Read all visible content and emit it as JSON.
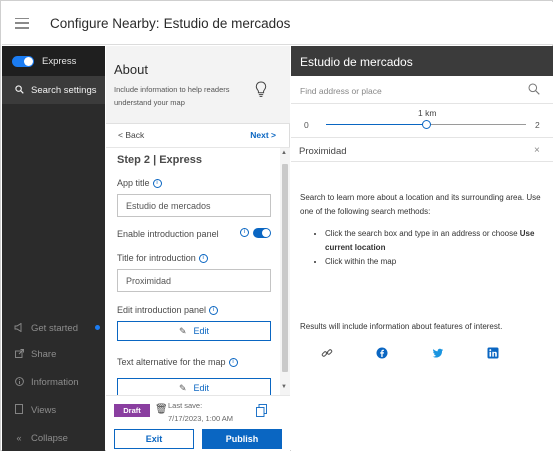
{
  "header": {
    "title": "Configure Nearby:",
    "subtitle": "Estudio de mercados"
  },
  "sidebar": {
    "toggle_label": "Express",
    "items": [
      {
        "label": "Search settings",
        "icon": "search-icon",
        "active": true
      },
      {
        "label": "Get started",
        "icon": "megaphone-icon",
        "active": false
      },
      {
        "label": "Share",
        "icon": "share-icon",
        "active": false
      },
      {
        "label": "Information",
        "icon": "info-icon",
        "active": false
      },
      {
        "label": "Views",
        "icon": "views-icon",
        "active": false
      },
      {
        "label": "Collapse",
        "icon": "double-chevron-left-icon",
        "active": false
      }
    ]
  },
  "panel": {
    "about_title": "About",
    "about_desc": "Include information to help readers understand your map",
    "back_label": "< Back",
    "next_label": "Next >",
    "step_title": "Step 2 | Express",
    "app_title_label": "App title",
    "app_title_value": "Estudio de mercados",
    "enable_intro_label": "Enable introduction panel",
    "intro_title_label": "Title for introduction",
    "intro_title_value": "Proximidad",
    "edit_intro_label": "Edit introduction panel",
    "edit_button_label": "Edit",
    "alt_text_label": "Text alternative for the map",
    "edit_button2_label": "Edit"
  },
  "footer": {
    "draft_label": "Draft",
    "last_save_label": "Last save:",
    "last_save_value": "7/17/2023, 1:00 AM",
    "exit_label": "Exit",
    "publish_label": "Publish"
  },
  "preview": {
    "title": "Estudio de mercados",
    "search_placeholder": "Find address or place",
    "slider": {
      "min_label": "0",
      "max_label": "2",
      "min": 0,
      "max": 2,
      "value": 1,
      "value_label": "1 km"
    },
    "section_title": "Proximidad",
    "close_label": "×",
    "intro_text": "Search to learn more about a location and its surrounding area. Use one of the following search methods:",
    "bullet1_text": "Click the search box and type in an address or choose ",
    "bullet1_bold": "Use current location",
    "bullet2_text": "Click within the map",
    "results_text": "Results will include information about features of interest.",
    "share_icons": [
      "link-icon",
      "facebook-icon",
      "twitter-icon",
      "linkedin-icon"
    ]
  },
  "colors": {
    "accent": "#0a66c2",
    "nav_bg": "#2b2b2b",
    "draft": "#8a3ea0",
    "preview_header": "#3b3b3b",
    "nav_dot": "#1b7cf2"
  }
}
